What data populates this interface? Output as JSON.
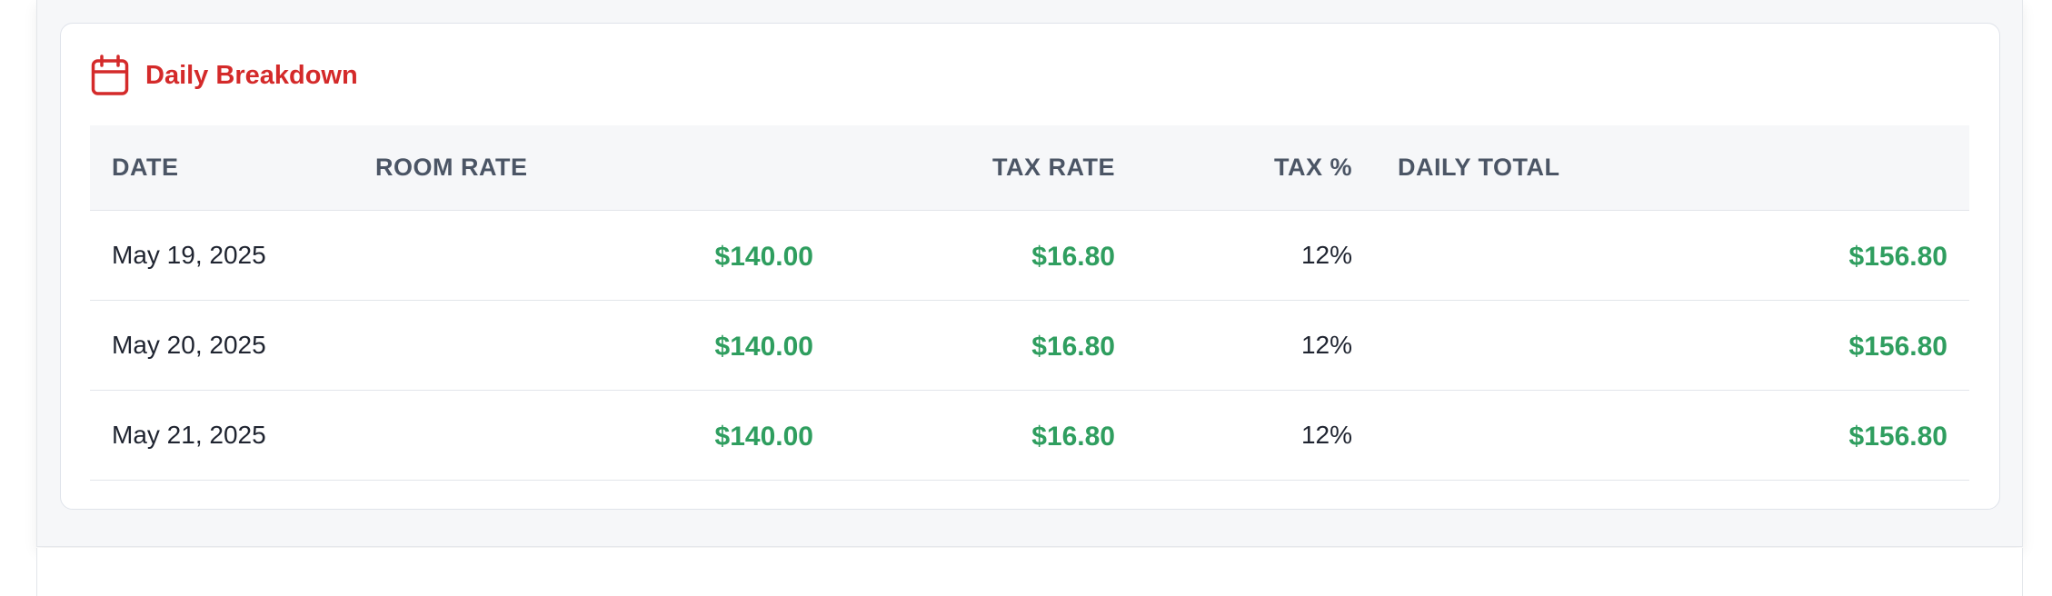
{
  "card": {
    "title": "Daily Breakdown",
    "icon": "calendar-icon",
    "accent_color": "#d42a2a",
    "money_color": "#2f9e5f"
  },
  "table": {
    "headers": {
      "date": "DATE",
      "room_rate": "ROOM RATE",
      "tax_rate": "TAX RATE",
      "tax_pct": "TAX %",
      "daily_total": "DAILY TOTAL"
    },
    "rows": [
      {
        "date": "May 19, 2025",
        "room_rate": "$140.00",
        "tax_rate": "$16.80",
        "tax_pct": "12%",
        "daily_total": "$156.80"
      },
      {
        "date": "May 20, 2025",
        "room_rate": "$140.00",
        "tax_rate": "$16.80",
        "tax_pct": "12%",
        "daily_total": "$156.80"
      },
      {
        "date": "May 21, 2025",
        "room_rate": "$140.00",
        "tax_rate": "$16.80",
        "tax_pct": "12%",
        "daily_total": "$156.80"
      }
    ]
  }
}
